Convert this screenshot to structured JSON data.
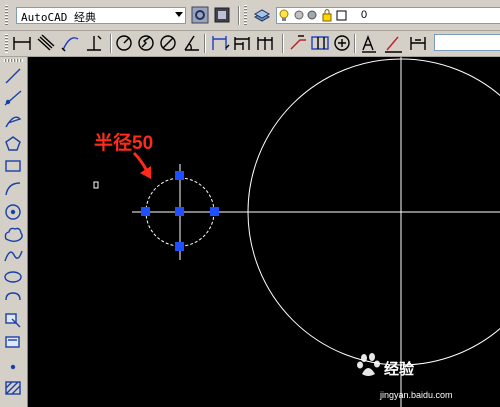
{
  "toolbar": {
    "workspace_value": "AutoCAD 经典",
    "layer_value": "0",
    "icons_row1": [
      "workspace-settings-icon",
      "customize-icon",
      "layer-properties-icon",
      "lightbulb-icon",
      "sun-icon",
      "freeze-icon",
      "lock-icon",
      "color-swatch-icon"
    ],
    "icons_row2": [
      "linear-dimension-icon",
      "aligned-dimension-icon",
      "arc-length-icon",
      "ordinate-icon",
      "radius-icon",
      "jogged-icon",
      "diameter-icon",
      "angular-icon",
      "quick-dimension-icon",
      "baseline-icon",
      "continue-icon",
      "quick-leader-icon",
      "tolerance-icon",
      "center-mark-icon",
      "dimension-edit-icon",
      "dimension-text-edit-icon",
      "dimension-update-icon"
    ]
  },
  "left_toolbar": {
    "icons": [
      "line-icon",
      "construction-line-icon",
      "polyline-icon",
      "polygon-icon",
      "rectangle-icon",
      "arc-icon",
      "circle-icon",
      "revision-cloud-icon",
      "spline-icon",
      "ellipse-icon",
      "ellipse-arc-icon",
      "insert-block-icon",
      "make-block-icon",
      "point-icon",
      "hatch-icon"
    ]
  },
  "canvas": {
    "annotation": "半径50",
    "colors": {
      "background": "#000000",
      "geometry": "#ffffff",
      "grip": "#1f4fff",
      "annotation": "#ff2a1a"
    }
  },
  "watermark": {
    "brand": "经验",
    "url": "jingyan.baidu.com"
  }
}
